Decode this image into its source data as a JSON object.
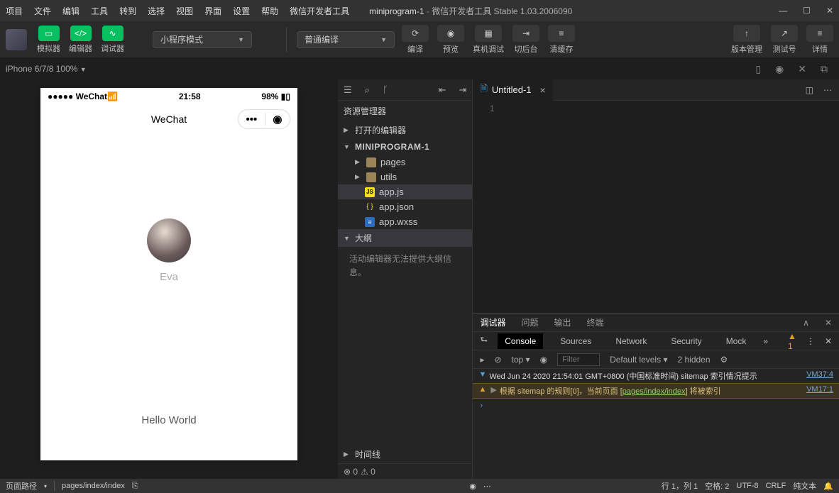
{
  "menu": {
    "items": [
      "项目",
      "文件",
      "编辑",
      "工具",
      "转到",
      "选择",
      "视图",
      "界面",
      "设置",
      "帮助",
      "微信开发者工具"
    ],
    "appname": "miniprogram-1",
    "suffix": "微信开发者工具 Stable 1.03.2006090"
  },
  "toolbar": {
    "sim": "模拟器",
    "edit": "编辑器",
    "debug": "调试器",
    "mode": "小程序模式",
    "compileMode": "普通编译",
    "compile": "编译",
    "preview": "预览",
    "remote": "真机调试",
    "background": "切后台",
    "cache": "清缓存",
    "version": "版本管理",
    "testid": "测试号",
    "detail": "详情"
  },
  "device": {
    "name": "iPhone 6/7/8 100%"
  },
  "phone": {
    "carrier": "WeChat",
    "time": "21:58",
    "battery": "98%",
    "navtitle": "WeChat",
    "username": "Eva",
    "hello": "Hello World"
  },
  "explorer": {
    "title": "资源管理器",
    "sections": {
      "open": "打开的编辑器",
      "project": "MINIPROGRAM-1",
      "outline": "大纲",
      "timeline": "时间线"
    },
    "folders": {
      "pages": "pages",
      "utils": "utils"
    },
    "files": {
      "appjs": "app.js",
      "appjson": "app.json",
      "appwxss": "app.wxss"
    },
    "outlineMsg": "活动编辑器无法提供大纲信息。"
  },
  "editor": {
    "tab": "Untitled-1",
    "line1": "1"
  },
  "devtools": {
    "tabs": {
      "debugger": "调试器",
      "problems": "问题",
      "output": "输出",
      "terminal": "终端"
    },
    "consoleTabs": {
      "console": "Console",
      "sources": "Sources",
      "network": "Network",
      "security": "Security",
      "mock": "Mock"
    },
    "warnCount": "1",
    "filter": {
      "top": "top",
      "placeholder": "Filter",
      "levels": "Default levels",
      "hidden": "2 hidden"
    },
    "log1": {
      "text": "Wed Jun 24 2020 21:54:01 GMT+0800 (中国标准时间) sitemap 索引情况提示",
      "src": "VM37:4"
    },
    "log2": {
      "prefix": "根据 sitemap 的规则[0]，当前页面 [",
      "page": "pages/index/index",
      "suffix": "] 将被索引",
      "src": "VM17:1"
    }
  },
  "status": {
    "pathLabel": "页面路径",
    "path": "pages/index/index",
    "err": "0",
    "warn": "0",
    "pos": "行 1，列 1",
    "spaces": "空格: 2",
    "enc": "UTF-8",
    "eol": "CRLF",
    "lang": "纯文本"
  }
}
